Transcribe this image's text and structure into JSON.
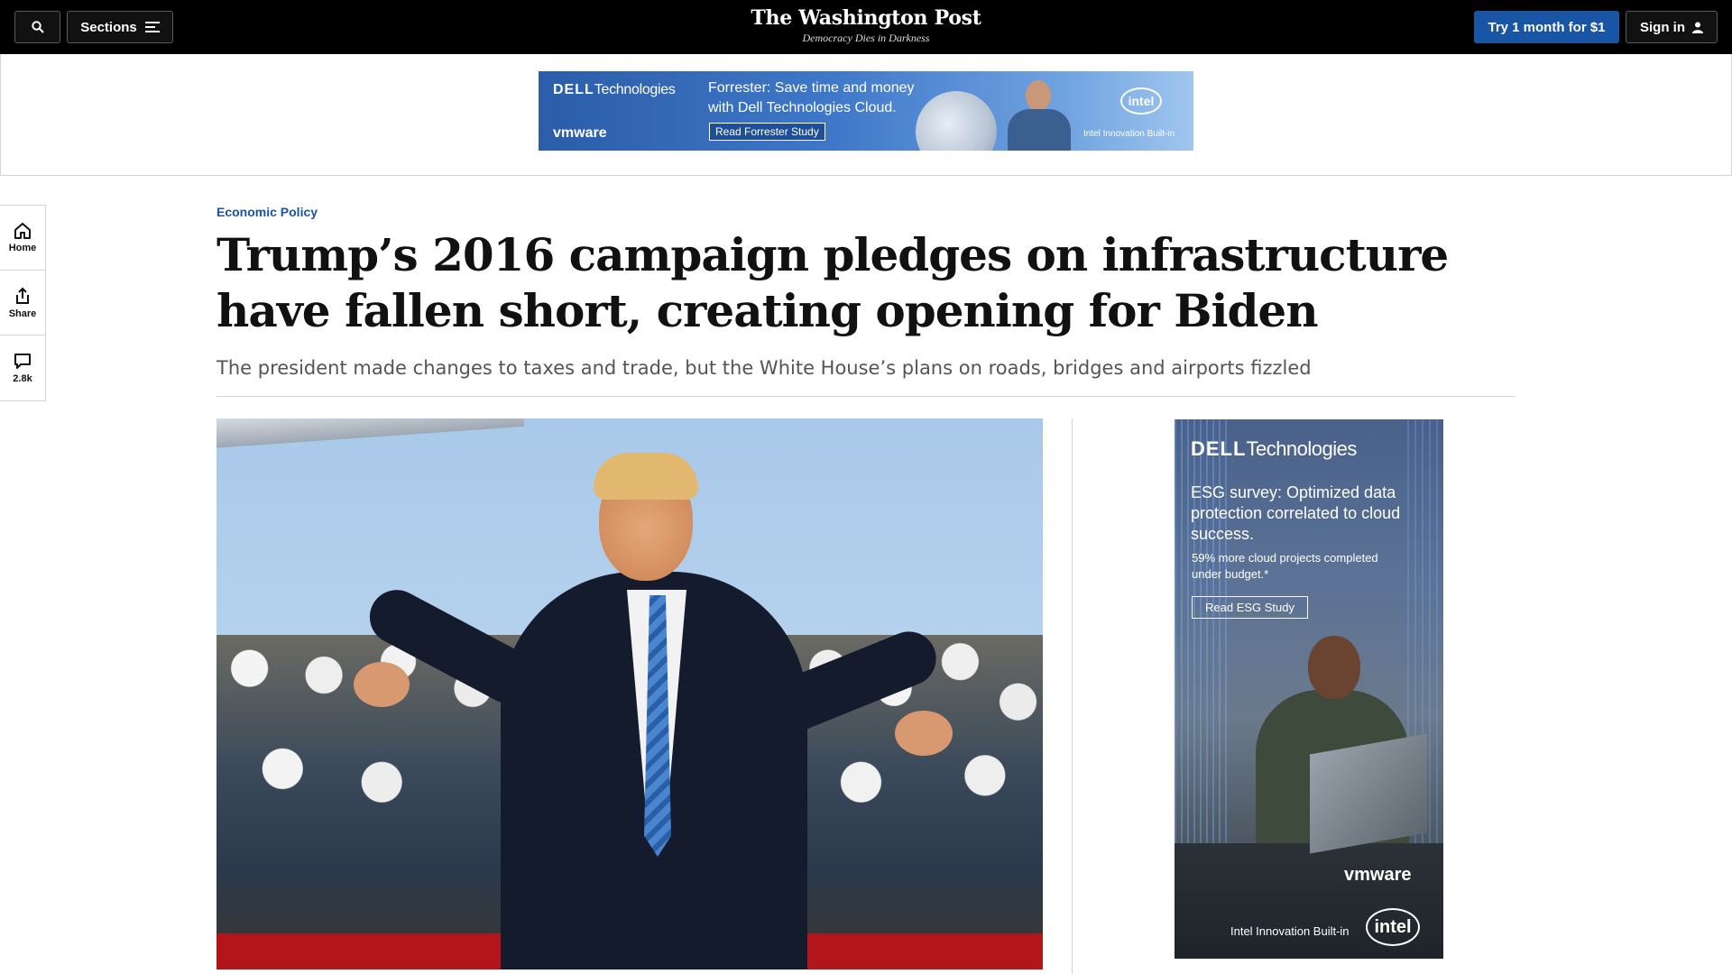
{
  "header": {
    "sections_label": "Sections",
    "brand_name": "The Washington Post",
    "brand_tagline": "Democracy Dies in Darkness",
    "subscribe_label": "Try 1 month for $1",
    "signin_label": "Sign in"
  },
  "top_ad": {
    "dell_brand": "Technologies",
    "dell_mark": "DELL",
    "headline": "Forrester: Save time and money with Dell Technologies Cloud.",
    "cta": "Read Forrester Study",
    "vmware": "vmware",
    "intel": "intel",
    "intel_tag": "Intel Innovation Built-in"
  },
  "rail": {
    "home_label": "Home",
    "share_label": "Share",
    "comments_count": "2.8k"
  },
  "article": {
    "kicker": "Economic Policy",
    "headline": "Trump’s 2016 campaign pledges on infrastructure have fallen short, creating opening for Biden",
    "dek": "The president made changes to taxes and trade, but the White House’s plans on roads, bridges and airports fizzled"
  },
  "side_ad": {
    "dell_mark": "DELL",
    "dell_brand": "Technologies",
    "headline": "ESG survey: Optimized data protection correlated to cloud success.",
    "body": "59% more cloud projects completed under budget.*",
    "cta": "Read ESG Study",
    "vmware": "vmware",
    "built_in": "Intel Innovation Built-in",
    "intel": "intel"
  },
  "colors": {
    "brand_blue": "#1955a5",
    "topbar": "#000000"
  }
}
